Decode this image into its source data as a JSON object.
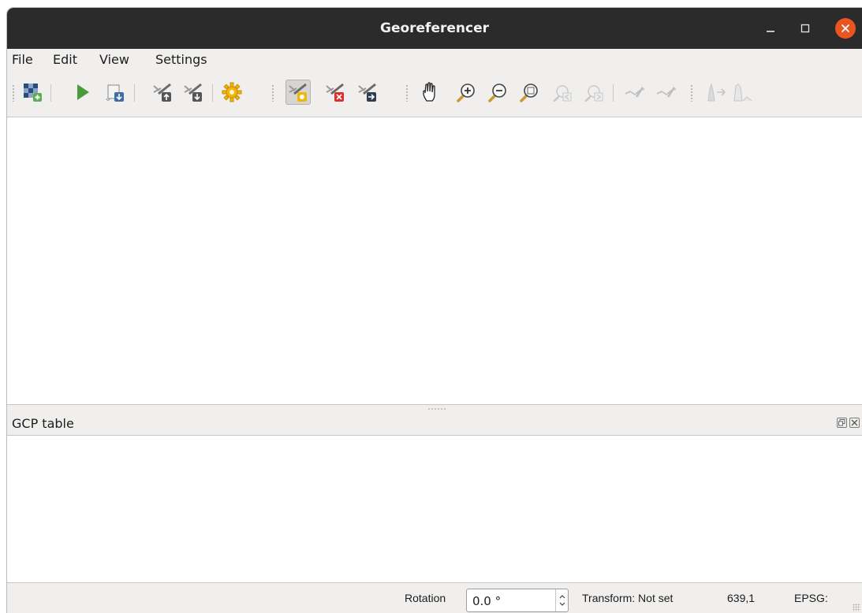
{
  "window": {
    "title": "Georeferencer",
    "controls": {
      "minimize_icon": "minimize-icon",
      "maximize_icon": "maximize-icon",
      "close_icon": "close-icon"
    },
    "close_color": "#e95420"
  },
  "menu": {
    "items": [
      "File",
      "Edit",
      "View",
      "Settings"
    ]
  },
  "toolbar": {
    "buttons": [
      {
        "name": "open-raster-icon",
        "enabled": true
      },
      {
        "name": "start-georeferencing-icon",
        "enabled": true
      },
      {
        "name": "generate-gdal-script-icon",
        "enabled": true
      },
      {
        "name": "load-gcp-points-icon",
        "enabled": true
      },
      {
        "name": "save-gcp-points-icon",
        "enabled": true
      },
      {
        "name": "transformation-settings-icon",
        "enabled": true
      },
      {
        "name": "add-point-icon",
        "enabled": true,
        "active": true
      },
      {
        "name": "delete-point-icon",
        "enabled": true
      },
      {
        "name": "move-gcp-point-icon",
        "enabled": true
      },
      {
        "name": "pan-icon",
        "enabled": true
      },
      {
        "name": "zoom-in-icon",
        "enabled": true
      },
      {
        "name": "zoom-out-icon",
        "enabled": true
      },
      {
        "name": "zoom-to-layer-icon",
        "enabled": true
      },
      {
        "name": "zoom-last-icon",
        "enabled": false
      },
      {
        "name": "zoom-next-icon",
        "enabled": false
      },
      {
        "name": "link-georeferencer-icon",
        "enabled": false
      },
      {
        "name": "link-qgis-icon",
        "enabled": false
      },
      {
        "name": "full-histogram-stretch-icon",
        "enabled": false
      },
      {
        "name": "local-histogram-stretch-icon",
        "enabled": false
      }
    ]
  },
  "gcp_panel": {
    "title": "GCP table",
    "float_icon": "float-panel-icon",
    "close_icon": "close-panel-icon"
  },
  "statusbar": {
    "rotation_label": "Rotation",
    "rotation_value": "0.0 °",
    "transform_text": "Transform: Not set",
    "coordinates": "639,1",
    "epsg_label": "EPSG:"
  }
}
